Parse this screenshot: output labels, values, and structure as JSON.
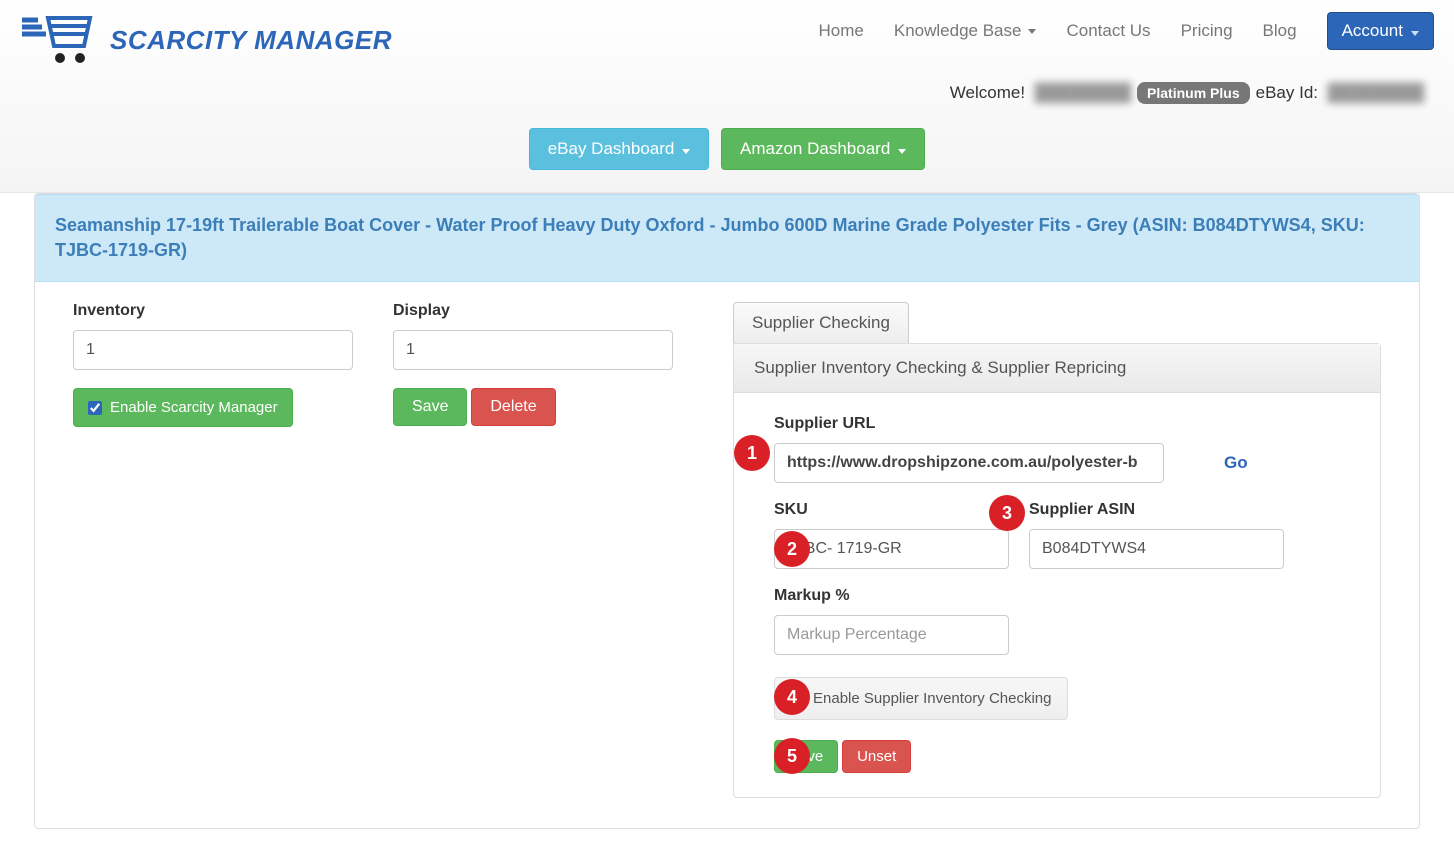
{
  "header": {
    "logo_text": "SCARCITY MANAGER",
    "nav": {
      "home": "Home",
      "knowledge_base": "Knowledge Base",
      "contact": "Contact Us",
      "pricing": "Pricing",
      "blog": "Blog",
      "account": "Account"
    },
    "welcome_label": "Welcome!",
    "user_name": "████████",
    "plan_badge": "Platinum Plus",
    "ebay_id_label": "eBay Id:",
    "ebay_id_value": "████████"
  },
  "dashboard_buttons": {
    "ebay": "eBay Dashboard",
    "amazon": "Amazon Dashboard"
  },
  "product_heading": "Seamanship 17-19ft Trailerable Boat Cover - Water Proof Heavy Duty Oxford - Jumbo 600D Marine Grade Polyester Fits - Grey (ASIN: B084DTYWS4, SKU: TJBC-1719-GR)",
  "form": {
    "inventory_label": "Inventory",
    "inventory_value": "1",
    "display_label": "Display",
    "display_value": "1",
    "enable_scarcity_label": "Enable Scarcity Manager",
    "enable_scarcity_checked": true,
    "save_btn": "Save",
    "delete_btn": "Delete"
  },
  "supplier": {
    "tab_label": "Supplier Checking",
    "panel_heading": "Supplier Inventory Checking & Supplier Repricing",
    "url_label": "Supplier URL",
    "url_value": "https://www.dropshipzone.com.au/polyester-b",
    "go_label": "Go",
    "sku_label": "SKU",
    "sku_value": "TJBC- 1719-GR",
    "asin_label": "Supplier ASIN",
    "asin_value": "B084DTYWS4",
    "markup_label": "Markup %",
    "markup_placeholder": "Markup Percentage",
    "markup_value": "",
    "enable_inventory_label": "Enable Supplier Inventory Checking",
    "enable_inventory_checked": true,
    "save_btn": "Save",
    "unset_btn": "Unset",
    "steps": {
      "s1": "1",
      "s2": "2",
      "s3": "3",
      "s4": "4",
      "s5": "5"
    }
  }
}
